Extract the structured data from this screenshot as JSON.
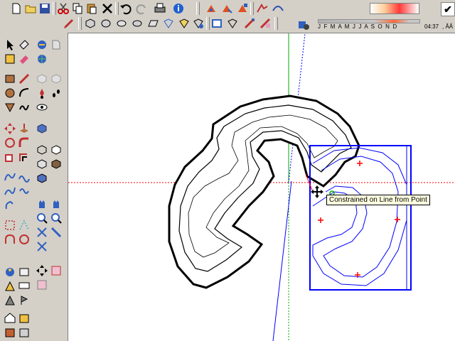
{
  "toolbar": {
    "months": "J  F  M  A  M  J  J  A  S  O  N  D",
    "time": "04:37",
    "ampm": ", ÂÂ",
    "check_mark": "✔"
  },
  "viewport": {
    "tooltip": "Constrained on Line from Point"
  },
  "colors": {
    "toolbar_bg": "#d4d0c8",
    "selection_blue": "#0000ff",
    "axis_red": "#ff0000",
    "axis_green": "#00aa00",
    "edge_black": "#000000",
    "tooltip_bg": "#ffffe1"
  }
}
